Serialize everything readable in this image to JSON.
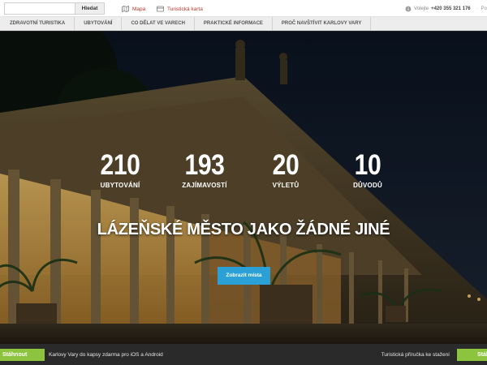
{
  "topbar": {
    "search_placeholder": "",
    "search_button": "Hledat",
    "map_link": "Mapa",
    "card_link": "Turistická karta",
    "phone_label": "Volejte",
    "phone_number": "+420 355 321 176",
    "phone_tail": "Po"
  },
  "nav": {
    "items": [
      "Zdravotní turistika",
      "Ubytování",
      "Co dělat ve Varech",
      "Praktické informace",
      "Proč navštívit Karlovy Vary"
    ]
  },
  "hero": {
    "stats": [
      {
        "value": "210",
        "label": "Ubytování"
      },
      {
        "value": "193",
        "label": "Zajímavostí"
      },
      {
        "value": "20",
        "label": "Výletů"
      },
      {
        "value": "10",
        "label": "Důvodů"
      }
    ],
    "tagline": "Lázeňské město jako žádné jiné",
    "cta": "Zobrazit místa"
  },
  "bottombar": {
    "download_left": "Stáhnout",
    "message_left": "Karlovy Vary do kapsy zdarma pro iOS a Android",
    "message_right": "Turistická příručka ke stažení",
    "download_right": "Stáhnout"
  },
  "colors": {
    "accent_red": "#c0392b",
    "cta_blue": "#2aa0d6",
    "download_green": "#8cc43e",
    "bottombar_bg": "#2a2a2a"
  },
  "icons": {
    "map": "map-icon",
    "card": "card-icon",
    "phone": "info-circle-icon"
  }
}
